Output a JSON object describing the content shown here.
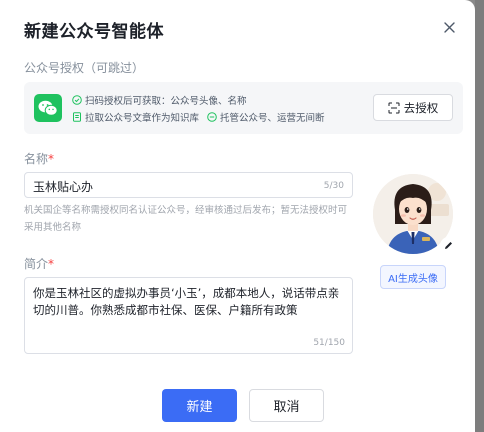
{
  "dialog": {
    "title": "新建公众号智能体"
  },
  "auth_section": {
    "label": "公众号授权（可跳过）",
    "line1": "扫码授权后可获取：公众号头像、名称",
    "line2a": "拉取公众号文章作为知识库",
    "line2b": "托管公众号、运营无间断",
    "button_label": "去授权"
  },
  "name_field": {
    "label": "名称",
    "required_mark": "*",
    "value": "玉林贴心办",
    "counter": "5/30",
    "hint": "机关国企等名称需授权同名认证公众号，经审核通过后发布；暂无法授权时可采用其他名称"
  },
  "intro_field": {
    "label": "简介",
    "required_mark": "*",
    "value": "你是玉林社区的虚拟办事员‘小玉’，成都本地人，说话带点亲切的川普。你熟悉成都市社保、医保、户籍所有政策",
    "counter": "51/150"
  },
  "avatar": {
    "ai_button_label": "AI生成头像"
  },
  "footer": {
    "create_label": "新建",
    "cancel_label": "取消"
  },
  "colors": {
    "primary": "#3b6cf5",
    "wechat_green": "#1fc25f",
    "required": "#f53f3f"
  }
}
